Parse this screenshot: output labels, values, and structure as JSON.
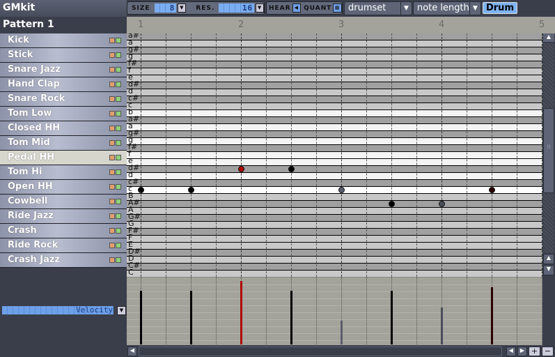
{
  "drumkit": "GMkit",
  "pattern": "Pattern 1",
  "toolbar": {
    "size_label": "SIZE",
    "size_value": "8",
    "res_label": "RES.",
    "res_value": "16",
    "hear_label": "HEAR",
    "quant_label": "QUANT",
    "editor_mode": "drumset",
    "property": "note length",
    "drum_toggle": "Drum"
  },
  "ruler": [
    "1",
    "2",
    "3",
    "4",
    "5"
  ],
  "instruments": [
    {
      "name": "Kick"
    },
    {
      "name": "Stick"
    },
    {
      "name": "Snare Jazz"
    },
    {
      "name": "Hand Clap"
    },
    {
      "name": "Snare Rock"
    },
    {
      "name": "Tom Low"
    },
    {
      "name": "Closed HH"
    },
    {
      "name": "Tom Mid"
    },
    {
      "name": "Pedal HH",
      "selected": true
    },
    {
      "name": "Tom Hi"
    },
    {
      "name": "Open HH"
    },
    {
      "name": "Cowbell"
    },
    {
      "name": "Ride Jazz"
    },
    {
      "name": "Crash"
    },
    {
      "name": "Ride Rock"
    },
    {
      "name": "Crash Jazz"
    }
  ],
  "piano_rows": [
    "a#",
    "a",
    "g#",
    "g",
    "f#",
    "f",
    "e",
    "d#",
    "d",
    "c#",
    "c",
    "b",
    "a#",
    "a",
    "g#",
    "g",
    "f#",
    "f",
    "e",
    "d#",
    "d",
    "c#",
    "c",
    "B",
    "A#",
    "A",
    "G#",
    "G",
    "F#",
    "F",
    "E",
    "D#",
    "D",
    "C#",
    "C"
  ],
  "notes": [
    {
      "step": 0,
      "pitch": "c",
      "velocity": 0.8,
      "color": "#000000"
    },
    {
      "step": 2,
      "pitch": "c",
      "velocity": 0.8,
      "color": "#000000"
    },
    {
      "step": 4,
      "pitch": "d#",
      "velocity": 0.95,
      "color": "#b00000"
    },
    {
      "step": 6,
      "pitch": "d#",
      "velocity": 0.8,
      "color": "#000000"
    },
    {
      "step": 8,
      "pitch": "c",
      "velocity": 0.35,
      "color": "#5a5d6c"
    },
    {
      "step": 10,
      "pitch": "A#",
      "velocity": 0.8,
      "color": "#000000"
    },
    {
      "step": 12,
      "pitch": "A#",
      "velocity": 0.55,
      "color": "#4a4d5a"
    },
    {
      "step": 14,
      "pitch": "c",
      "velocity": 0.85,
      "color": "#2a0000"
    }
  ],
  "velocity_selector": "Velocity"
}
